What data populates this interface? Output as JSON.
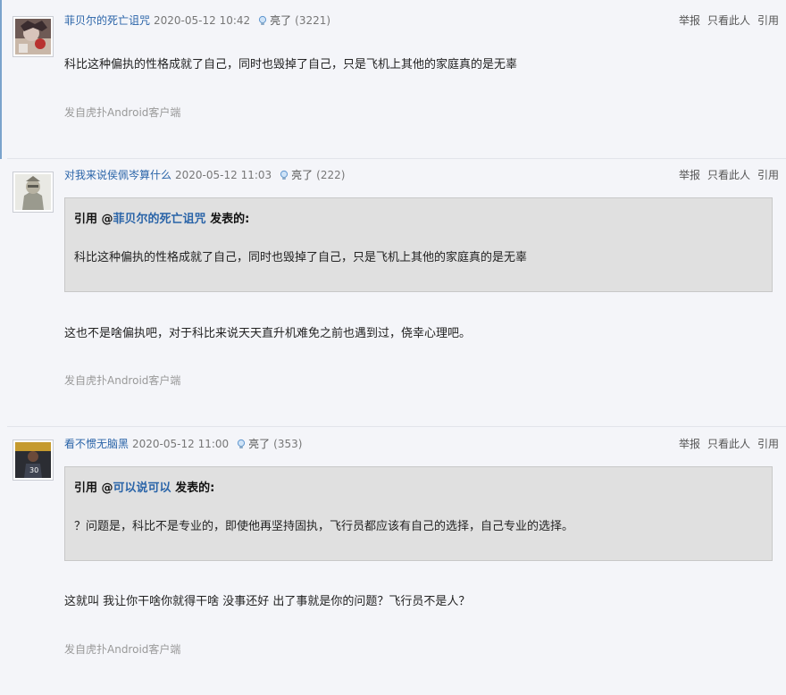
{
  "posts": [
    {
      "user": "菲贝尔的死亡诅咒",
      "time": "2020-05-12 10:42",
      "light_label": "亮了",
      "light_count": "(3221)",
      "actions": [
        "举报",
        "只看此人",
        "引用"
      ],
      "content": "科比这种偏执的性格成就了自己，同时也毁掉了自己，只是飞机上其他的家庭真的是无辜",
      "source": "发自虎扑Android客户端",
      "avatar_icon": "anime-character-avatar"
    },
    {
      "user": "对我来说侯佩岑算什么",
      "time": "2020-05-12 11:03",
      "light_label": "亮了",
      "light_count": "(222)",
      "actions": [
        "举报",
        "只看此人",
        "引用"
      ],
      "quote": {
        "prefix": "引用 @",
        "user": "菲贝尔的死亡诅咒",
        "suffix": " 发表的:",
        "text": "科比这种偏执的性格成就了自己，同时也毁掉了自己，只是飞机上其他的家庭真的是无辜"
      },
      "content": "这也不是啥偏执吧，对于科比来说天天直升机难免之前也遇到过，侥幸心理吧。",
      "source": "发自虎扑Android客户端",
      "avatar_icon": "armored-figure-avatar"
    },
    {
      "user": "看不惯无脑黑",
      "time": "2020-05-12 11:00",
      "light_label": "亮了",
      "light_count": "(353)",
      "actions": [
        "举报",
        "只看此人",
        "引用"
      ],
      "quote": {
        "prefix": "引用 @",
        "user": "可以说可以",
        "suffix": " 发表的:",
        "text": "？问题是，科比不是专业的，即使他再坚持固执，飞行员都应该有自己的选择，自己专业的选择。"
      },
      "content": "这就叫 我让你干啥你就得干啥 没事还好 出了事就是你的问题？飞行员不是人？",
      "source": "发自虎扑Android客户端",
      "avatar_icon": "basketball-player-avatar"
    }
  ]
}
